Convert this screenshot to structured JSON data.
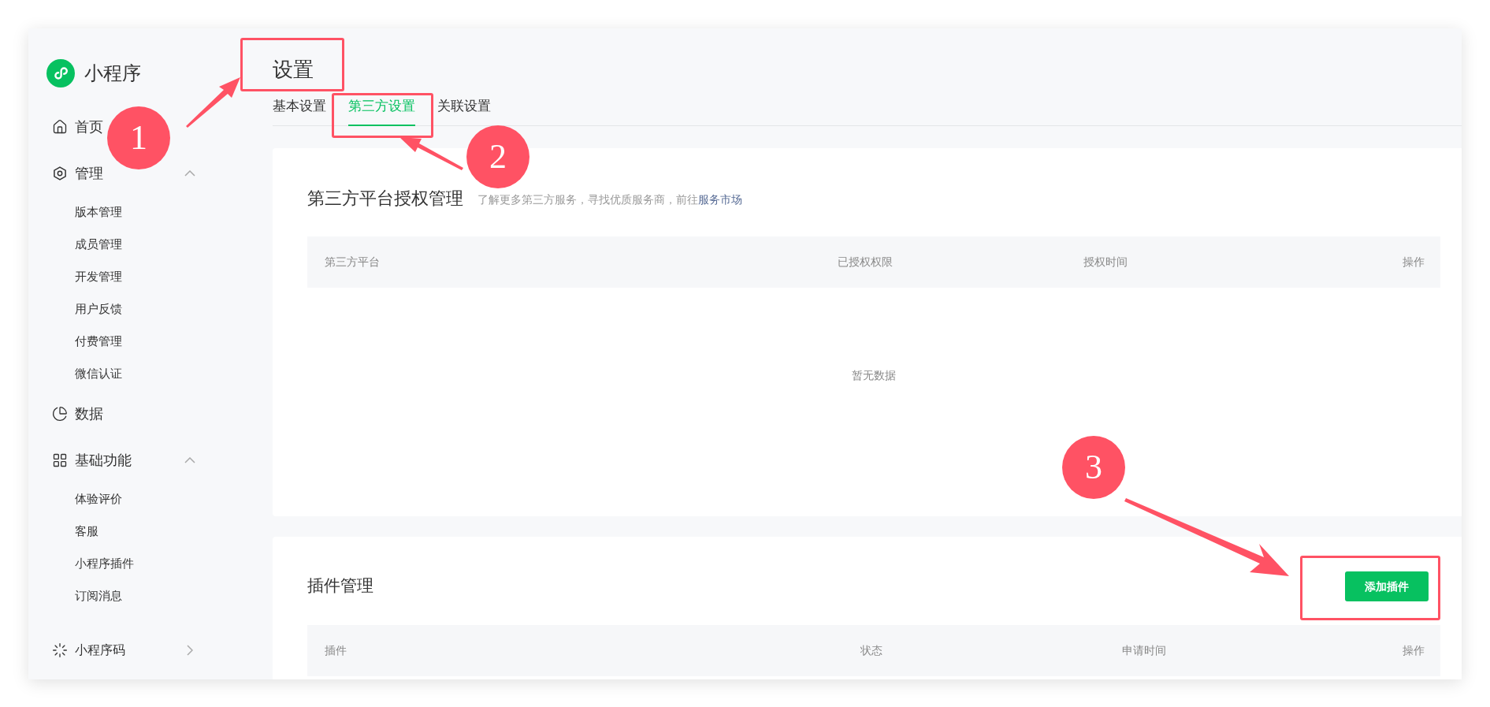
{
  "sidebar": {
    "logo_text": "小程序",
    "items": [
      {
        "label": "首页"
      },
      {
        "label": "管理",
        "expanded": true,
        "children": [
          {
            "label": "版本管理"
          },
          {
            "label": "成员管理"
          },
          {
            "label": "开发管理"
          },
          {
            "label": "用户反馈"
          },
          {
            "label": "付费管理"
          },
          {
            "label": "微信认证"
          }
        ]
      },
      {
        "label": "数据"
      },
      {
        "label": "基础功能",
        "expanded": true,
        "children": [
          {
            "label": "体验评价"
          },
          {
            "label": "客服"
          },
          {
            "label": "小程序插件"
          },
          {
            "label": "订阅消息"
          }
        ]
      },
      {
        "label": "小程序码",
        "expanded": false
      }
    ]
  },
  "page": {
    "title": "设置"
  },
  "tabs": [
    {
      "label": "基本设置",
      "selected": false
    },
    {
      "label": "第三方设置",
      "selected": true
    },
    {
      "label": "关联设置",
      "selected": false
    }
  ],
  "third_party_card": {
    "title": "第三方平台授权管理",
    "subtitle": "了解更多第三方服务，寻找优质服务商，前往",
    "link": "服务市场",
    "columns": [
      "第三方平台",
      "已授权权限",
      "授权时间",
      "操作"
    ],
    "empty_text": "暂无数据"
  },
  "plugin_card": {
    "title": "插件管理",
    "button": "添加插件",
    "columns": [
      "插件",
      "状态",
      "申请时间",
      "操作"
    ]
  },
  "annotations": [
    {
      "label": "1"
    },
    {
      "label": "2"
    },
    {
      "label": "3"
    }
  ]
}
